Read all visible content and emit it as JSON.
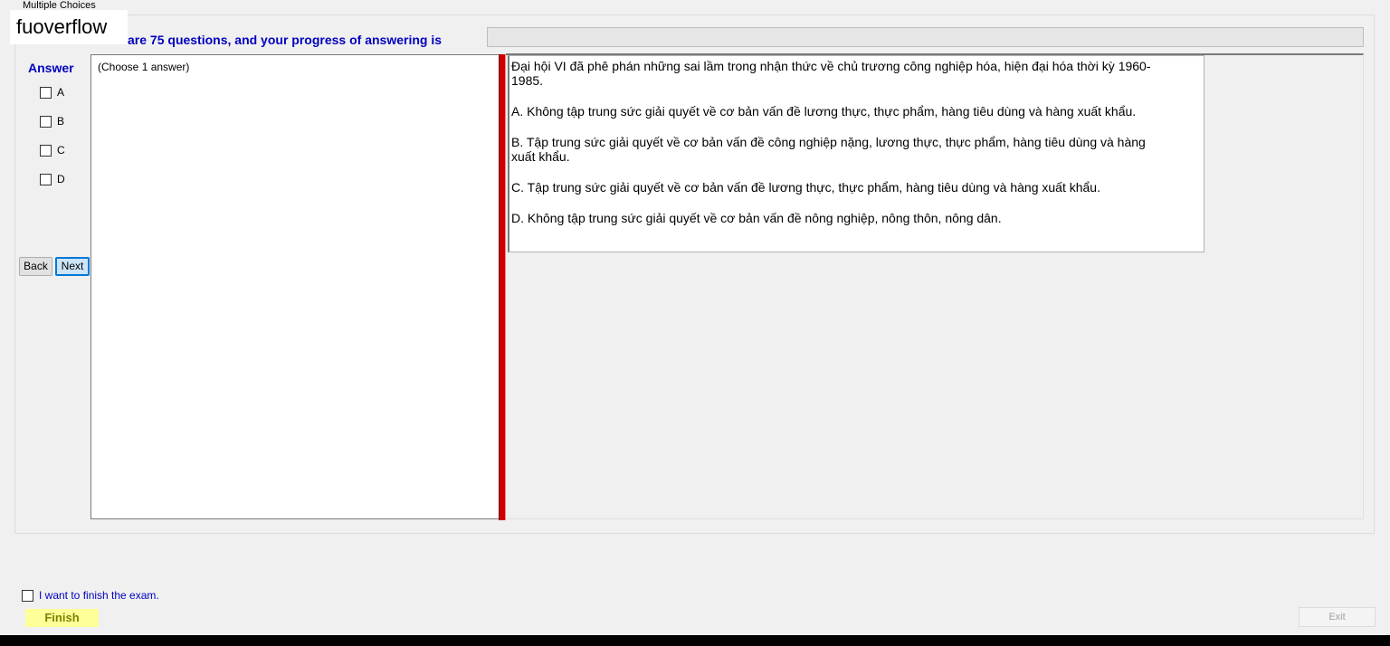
{
  "window": {
    "group_title": "Multiple Choices",
    "watermark": "fuoverflow"
  },
  "progress": {
    "label": "There are 75 questions, and your progress of answering is",
    "value_percent": 0
  },
  "answer": {
    "title": "Answer",
    "options": [
      "A",
      "B",
      "C",
      "D"
    ],
    "back_label": "Back",
    "next_label": "Next"
  },
  "question": {
    "hint": "(Choose 1 answer)",
    "stem": "Đại hội VI đã phê phán những sai lầm trong nhận thức về chủ trương công nghiệp hóa, hiện đại hóa thời kỳ 1960-1985.",
    "choices": [
      "A.  Không tập trung sức giải quyết về cơ bản vấn đề lương thực, thực phẩm, hàng tiêu dùng và hàng xuất khẩu.",
      "B.  Tập trung sức giải quyết về cơ bản vấn đề công nghiệp nặng, lương thực, thực phẩm, hàng tiêu dùng và hàng xuất khẩu.",
      "C.  Tập trung sức giải quyết về cơ bản vấn đề lương thực, thực phẩm, hàng tiêu dùng và hàng xuất khẩu.",
      "D.  Không tập trung sức giải quyết về cơ bản vấn đề nông nghiệp, nông thôn, nông dân."
    ]
  },
  "footer": {
    "finish_check_label": "I want to finish the exam.",
    "finish_label": "Finish",
    "exit_label": "Exit"
  },
  "colors": {
    "label_blue": "#0000c0",
    "splitter_red": "#cc0000",
    "finish_bg": "#ffff99"
  }
}
